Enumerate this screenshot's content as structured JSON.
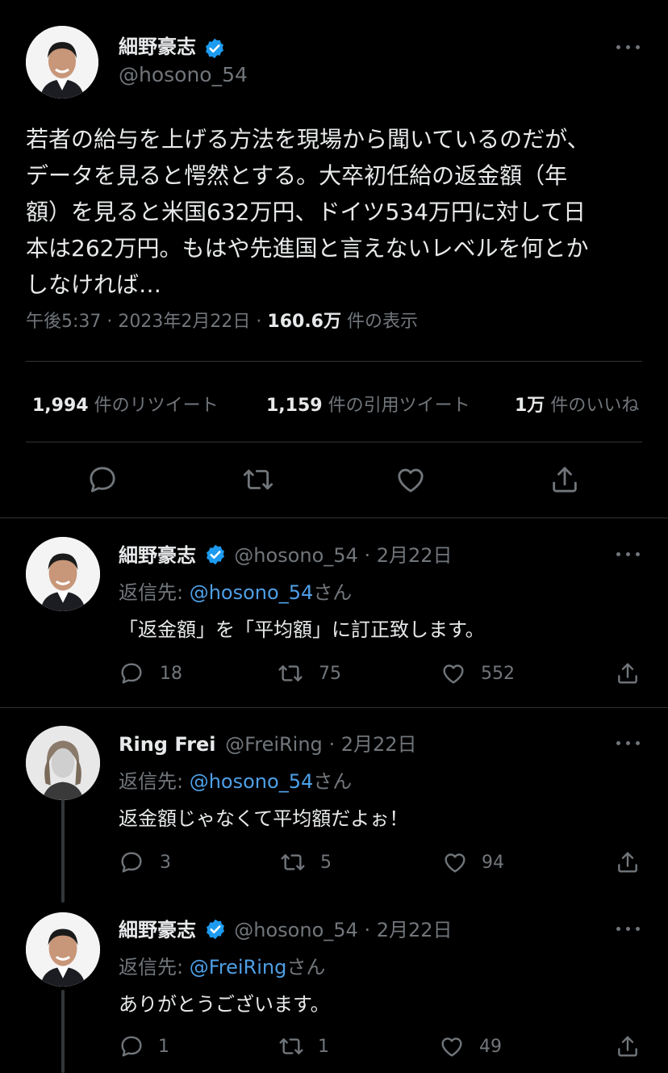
{
  "main_tweet": {
    "author_name": "細野豪志",
    "handle": "@hosono_54",
    "text_lines": [
      "若者の給与を上げる方法を現場から聞いているのだが、",
      "データを見ると愕然とする。大卒初任給の返金額（年",
      "額）を見ると米国632万円、ドイツ534万円に対して日",
      "本は262万円。もはや先進国と言えないレベルを何とか",
      "しなければ…"
    ],
    "time": "午後5:37",
    "date": "2023年2月22日",
    "dot": "·",
    "views_count": "160.6万",
    "views_label": "件の表示",
    "retweets_count": "1,994",
    "retweets_label": "件のリツイート",
    "quotes_count": "1,159",
    "quotes_label": "件の引用ツイート",
    "likes_count": "1万",
    "likes_label": "件のいいね"
  },
  "replies": [
    {
      "author_name": "細野豪志",
      "handle": "@hosono_54",
      "date": "2月22日",
      "dot": "·",
      "reply_prefix": "返信先: ",
      "reply_to": "@hosono_54",
      "reply_suffix": "さん",
      "text": "「返金額」を「平均額」に訂正致します。",
      "replies": "18",
      "retweets": "75",
      "likes": "552"
    },
    {
      "author_name": "Ring Frei",
      "handle": "@FreiRing",
      "date": "2月22日",
      "dot": "·",
      "reply_prefix": "返信先: ",
      "reply_to": "@hosono_54",
      "reply_suffix": "さん",
      "text": "返金額じゃなくて平均額だよぉ！",
      "replies": "3",
      "retweets": "5",
      "likes": "94"
    },
    {
      "author_name": "細野豪志",
      "handle": "@hosono_54",
      "date": "2月22日",
      "dot": "·",
      "reply_prefix": "返信先: ",
      "reply_to": "@FreiRing",
      "reply_suffix": "さん",
      "text": "ありがとうございます。",
      "replies": "1",
      "retweets": "1",
      "likes": "49"
    }
  ],
  "colors": {
    "background": "#000000",
    "text": "#e7e9ea",
    "secondary": "#71767b",
    "link": "#4e9fe6",
    "verified": "#1d9bf0",
    "divider": "#2f3336"
  }
}
